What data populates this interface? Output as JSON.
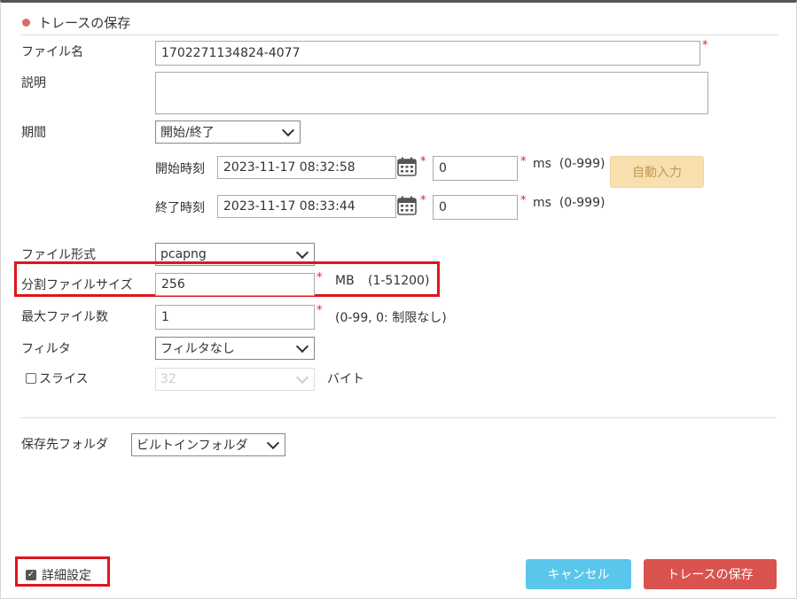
{
  "dialog": {
    "title": "トレースの保存"
  },
  "file_name": {
    "label": "ファイル名",
    "value": "1702271134824-4077",
    "required": "*"
  },
  "description": {
    "label": "説明",
    "value": ""
  },
  "period": {
    "label": "期間",
    "selected": "開始/終了",
    "start": {
      "label": "開始時刻",
      "datetime": "2023-11-17 08:32:58",
      "ms": "0",
      "ms_hint": "ms  (0-999)"
    },
    "end": {
      "label": "終了時刻",
      "datetime": "2023-11-17 08:33:44",
      "ms": "0",
      "ms_hint": "ms  (0-999)"
    },
    "auto_button": "自動入力",
    "required": "*"
  },
  "file_format": {
    "label": "ファイル形式",
    "selected": "pcapng"
  },
  "split_size": {
    "label": "分割ファイルサイズ",
    "value": "256",
    "unit": "MB",
    "range": "(1-51200)",
    "required": "*"
  },
  "max_files": {
    "label": "最大ファイル数",
    "value": "1",
    "hint": "(0-99, 0: 制限なし)",
    "required": "*"
  },
  "filter": {
    "label": "フィルタ",
    "selected": "フィルタなし"
  },
  "slice": {
    "label": "スライス",
    "value": "32",
    "unit": "バイト",
    "checked": false
  },
  "save_folder": {
    "label": "保存先フォルダ",
    "selected": "ビルトインフォルダ"
  },
  "advanced": {
    "label": "詳細設定",
    "checked": true
  },
  "buttons": {
    "cancel": "キャンセル",
    "save": "トレースの保存"
  },
  "colors": {
    "accent_red": "#d9534f",
    "cancel_blue": "#5bc6ec",
    "highlight": "#e0141e"
  },
  "icons": [
    "calendar-icon",
    "chevron-down-icon",
    "checkbox-icon"
  ]
}
